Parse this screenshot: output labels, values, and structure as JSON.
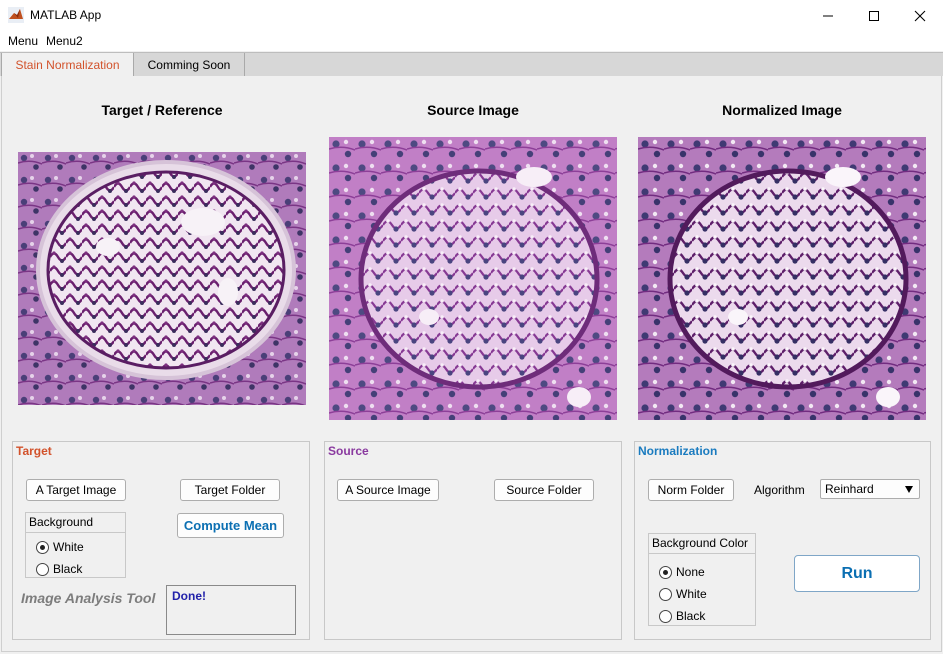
{
  "window": {
    "title": "MATLAB App"
  },
  "menubar": {
    "items": [
      "Menu",
      "Menu2"
    ]
  },
  "tabs": [
    {
      "label": "Stain Normalization",
      "active": true
    },
    {
      "label": "Comming Soon",
      "active": false
    }
  ],
  "images": {
    "target_title": "Target / Reference",
    "source_title": "Source Image",
    "normalized_title": "Normalized Image"
  },
  "target_panel": {
    "title": "Target",
    "title_color": "#d2522b",
    "target_image_button": "A Target Image",
    "target_folder_button": "Target Folder",
    "compute_mean_button": "Compute Mean",
    "background_label": "Background",
    "background_options": [
      "White",
      "Black"
    ],
    "background_selected": "White",
    "tool_label": "Image Analysis Tool",
    "status_text": "Done!"
  },
  "source_panel": {
    "title": "Source",
    "title_color": "#8a3a9f",
    "source_image_button": "A Source Image",
    "source_folder_button": "Source Folder"
  },
  "normalization_panel": {
    "title": "Normalization",
    "title_color": "#1a7bbf",
    "norm_folder_button": "Norm Folder",
    "algorithm_label": "Algorithm",
    "algorithm_value": "Reinhard",
    "background_color_label": "Background Color",
    "background_color_options": [
      "None",
      "White",
      "Black"
    ],
    "background_color_selected": "None",
    "run_button": "Run"
  }
}
